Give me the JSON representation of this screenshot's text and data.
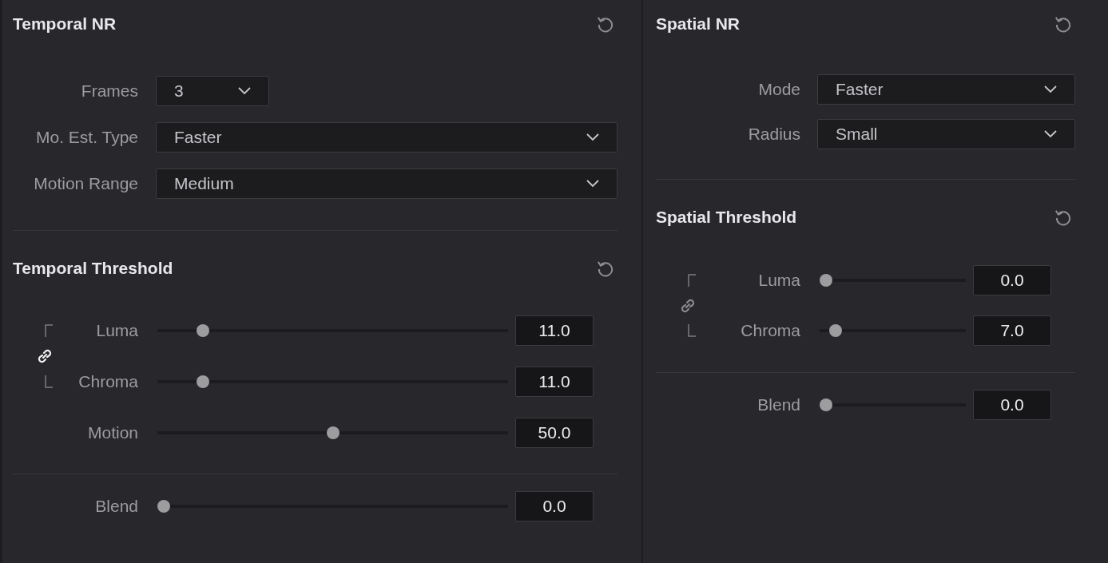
{
  "panels": [
    {
      "title": "Temporal NR",
      "dropdowns": [
        {
          "label": "Frames",
          "value": "3",
          "kind": "short"
        },
        {
          "label": "Mo. Est. Type",
          "value": "Faster",
          "kind": "full"
        },
        {
          "label": "Motion Range",
          "value": "Medium",
          "kind": "full"
        }
      ],
      "threshold": {
        "title": "Temporal Threshold",
        "linked": true,
        "linked_sliders": [
          {
            "label": "Luma",
            "level": 0.115,
            "reading": "11.0"
          },
          {
            "label": "Chroma",
            "level": 0.115,
            "reading": "11.0"
          }
        ],
        "sliders": [
          {
            "label": "Motion",
            "level": 0.5,
            "reading": "50.0"
          }
        ]
      },
      "blend": {
        "label": "Blend",
        "level": 0,
        "reading": "0.0"
      }
    },
    {
      "title": "Spatial NR",
      "dropdowns": [
        {
          "label": "Mode",
          "value": "Faster",
          "kind": "full"
        },
        {
          "label": "Radius",
          "value": "Small",
          "kind": "full"
        }
      ],
      "threshold": {
        "title": "Spatial Threshold",
        "linked": false,
        "linked_sliders": [
          {
            "label": "Luma",
            "level": 0,
            "reading": "0.0"
          },
          {
            "label": "Chroma",
            "level": 0.07,
            "reading": "7.0"
          }
        ]
      },
      "blend": {
        "label": "Blend",
        "level": 0,
        "reading": "0.0"
      }
    }
  ]
}
